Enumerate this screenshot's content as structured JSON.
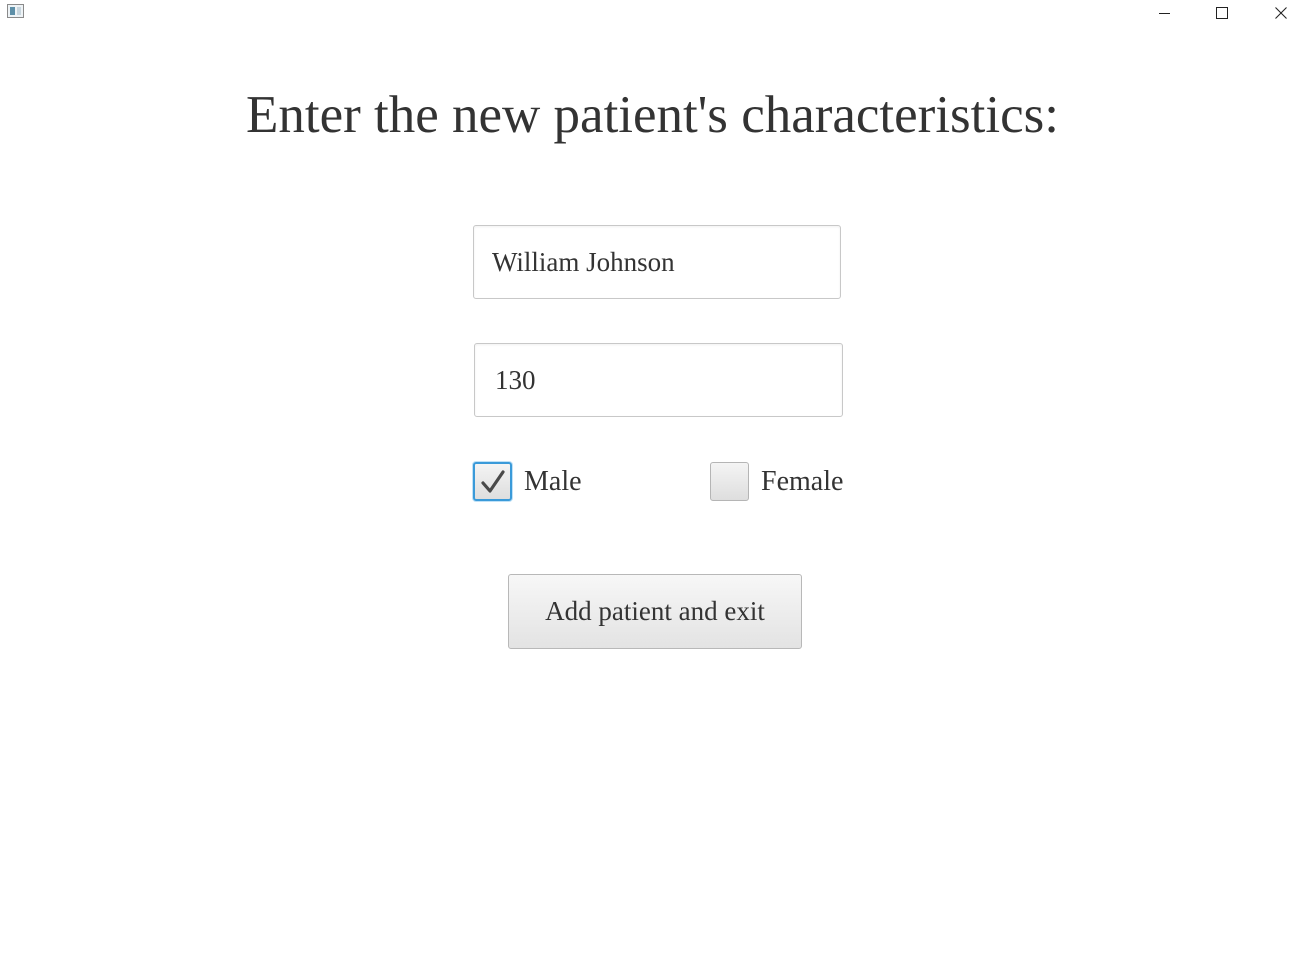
{
  "window": {
    "icon": "app-window-icon",
    "controls": {
      "minimize_icon": "minimize-icon",
      "maximize_icon": "maximize-icon",
      "close_icon": "close-icon"
    }
  },
  "form": {
    "title": "Enter the new patient's characteristics:",
    "name_value": "William Johnson",
    "weight_value": "130",
    "gender_options": [
      {
        "label": "Male",
        "checked": true
      },
      {
        "label": "Female",
        "checked": false
      }
    ],
    "submit_label": "Add patient and exit"
  },
  "colors": {
    "focus_accent": "#3a9ad9",
    "text": "#333333",
    "background": "#ffffff"
  }
}
